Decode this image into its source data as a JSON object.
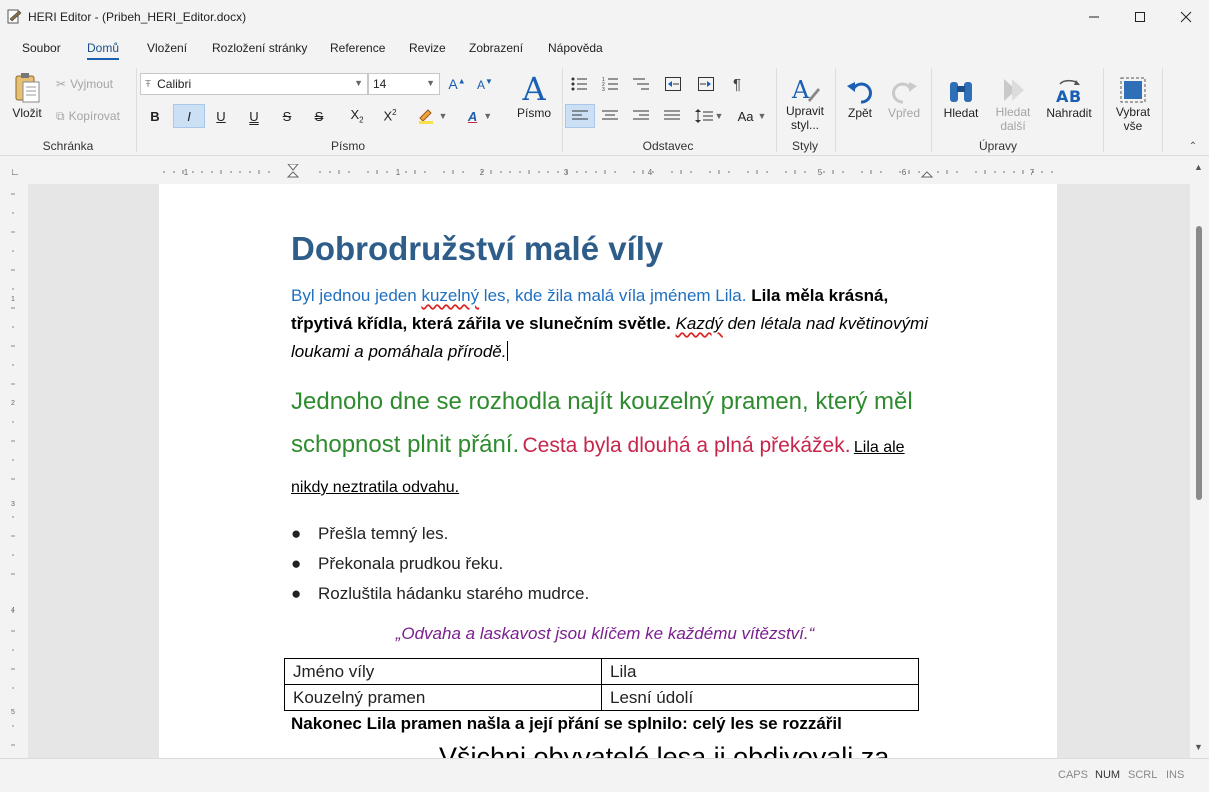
{
  "window": {
    "title": "HERI Editor - (Pribeh_HERI_Editor.docx)"
  },
  "menu": {
    "items": [
      "Soubor",
      "Domů",
      "Vložení",
      "Rozložení stránky",
      "Reference",
      "Revize",
      "Zobrazení",
      "Nápověda"
    ],
    "active": "Domů"
  },
  "ribbon": {
    "clipboard": {
      "paste": "Vložit",
      "cut": "Vyjmout",
      "copy": "Kopírovat",
      "label": "Schránka"
    },
    "font": {
      "family": "Calibri",
      "size": "14",
      "label": "Písmo",
      "big_button": "Písmo"
    },
    "paragraph": {
      "label": "Odstavec",
      "case_button": "Aa"
    },
    "styles": {
      "edit_line1": "Upravit",
      "edit_line2": "styl...",
      "label": "Styly"
    },
    "editing": {
      "undo": "Zpět",
      "redo": "Vpřed",
      "find": "Hledat",
      "find_next_line1": "Hledat",
      "find_next_line2": "další",
      "replace": "Nahradit",
      "select_all_line1": "Vybrat",
      "select_all_line2": "vše",
      "label": "Úpravy"
    }
  },
  "ruler": {
    "numbers": [
      "1",
      "1",
      "2",
      "3",
      "4",
      "5",
      "6",
      "7"
    ]
  },
  "vruler": {
    "numbers": [
      "1",
      "2",
      "3",
      "4",
      "5"
    ]
  },
  "document": {
    "heading": "Dobrodružství malé víly",
    "p1_blue_a": "Byl jednou jeden ",
    "p1_blue_b": "kuzelný",
    "p1_blue_c": " les, kde žila malá víla jménem Lila.",
    "p1_bold": "Lila měla krásná, třpytivá křídla, která zářila ve slunečním světle.",
    "p1_italic_a": "Kazdý",
    "p1_italic_b": " den létala nad květinovými loukami a pomáhala přírodě.",
    "p2_green": "Jednoho dne se rozhodla najít kouzelný pramen, který měl schopnost plnit přání.",
    "p2_red": "Cesta byla dlouhá a plná překážek.",
    "p2_underline": "Lila ale nikdy neztratila odvahu.",
    "bullets": [
      "Přešla temný les.",
      "Překonala prudkou řeku.",
      "Rozluštila hádanku starého mudrce."
    ],
    "quote": "„Odvaha a laskavost jsou klíčem ke každému vítězství.“",
    "table": [
      [
        "Jméno víly",
        "Lila"
      ],
      [
        "Kouzelný pramen",
        "Lesní údolí"
      ]
    ],
    "final_bold": "Nakonec Lila pramen našla a její přání se splnilo: celý les se rozzářil",
    "final_large": "Všichni obyvatelé lesa ji obdivovali za"
  },
  "status": {
    "caps": "CAPS",
    "num": "NUM",
    "scrl": "SCRL",
    "ins": "INS"
  },
  "colors": {
    "heading": "#2f5d8a",
    "blue": "#1f6fbf",
    "green": "#2e8b2e",
    "red": "#c8254a",
    "purple": "#7a1f8f",
    "accent": "#1a5fb4"
  }
}
